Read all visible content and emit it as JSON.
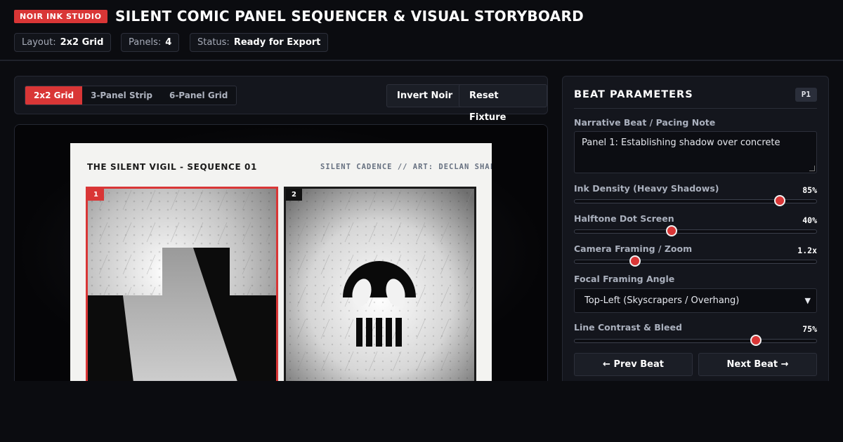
{
  "header": {
    "brand": "NOIR INK STUDIO",
    "title": "SILENT COMIC PANEL SEQUENCER & VISUAL STORYBOARD",
    "chips": [
      {
        "key": "Layout:",
        "value": "2x2 Grid"
      },
      {
        "key": "Panels:",
        "value": "4"
      },
      {
        "key": "Status:",
        "value": "Ready for Export"
      }
    ]
  },
  "toolbar": {
    "layouts": [
      "2x2 Grid",
      "3-Panel Strip",
      "6-Panel Grid"
    ],
    "active_layout": "2x2 Grid",
    "invert_label": "Invert Noir",
    "reset_label": "Reset Fixture"
  },
  "sheet": {
    "title": "THE SILENT VIGIL - SEQUENCE 01",
    "credit": "SILENT CADENCE // ART: DECLAN SHALV",
    "panels": [
      {
        "number": "1",
        "selected": true,
        "art": "city-buildings"
      },
      {
        "number": "2",
        "selected": false,
        "art": "skull"
      }
    ]
  },
  "side": {
    "title": "BEAT PARAMETERS",
    "badge": "P1",
    "note_label": "Narrative Beat / Pacing Note",
    "note_value": "Panel 1: Establishing shadow over concrete",
    "ink_label": "Ink Density (Heavy Shadows)",
    "ink_value": "85%",
    "ink_level": 0.85,
    "halftone_label": "Halftone Dot Screen",
    "halftone_value": "40%",
    "halftone_level": 0.4,
    "zoom_label": "Camera Framing / Zoom",
    "zoom_value": "1.2x",
    "zoom_level": 0.25,
    "angle_label": "Focal Framing Angle",
    "angle_value": "Top-Left (Skyscrapers / Overhang)",
    "contrast_label": "Line Contrast & Bleed",
    "contrast_value": "75%",
    "contrast_level": 0.75,
    "prev_label": "← Prev Beat",
    "next_label": "Next Beat →"
  },
  "colors": {
    "accent": "#d93636",
    "background": "#0b0c10",
    "panel_bg": "#14161d"
  }
}
